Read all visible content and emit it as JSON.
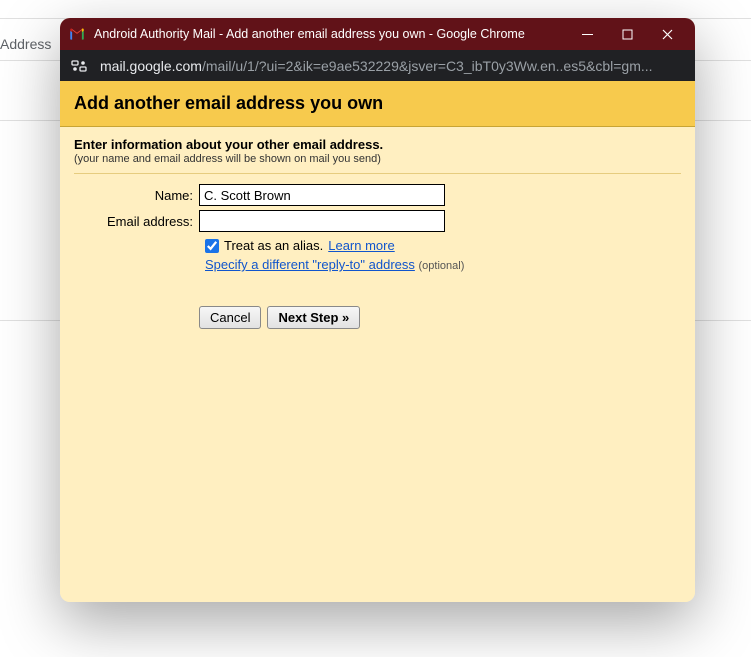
{
  "background": {
    "partial_label": "Address"
  },
  "window": {
    "title": "Android Authority Mail - Add another email address you own - Google Chrome"
  },
  "url": {
    "domain": "mail.google.com",
    "path": "/mail/u/1/?ui=2&ik=e9ae532229&jsver=C3_ibT0y3Ww.en..es5&cbl=gm..."
  },
  "page": {
    "heading": "Add another email address you own",
    "intro_main": "Enter information about your other email address.",
    "intro_sub": "(your name and email address will be shown on mail you send)"
  },
  "form": {
    "name_label": "Name:",
    "name_value": "C. Scott Brown",
    "email_label": "Email address:",
    "email_value": "",
    "alias_checked": true,
    "alias_label": "Treat as an alias.",
    "learn_more": "Learn more",
    "reply_to_link": "Specify a different \"reply-to\" address",
    "optional": "(optional)"
  },
  "buttons": {
    "cancel": "Cancel",
    "next": "Next Step »"
  }
}
